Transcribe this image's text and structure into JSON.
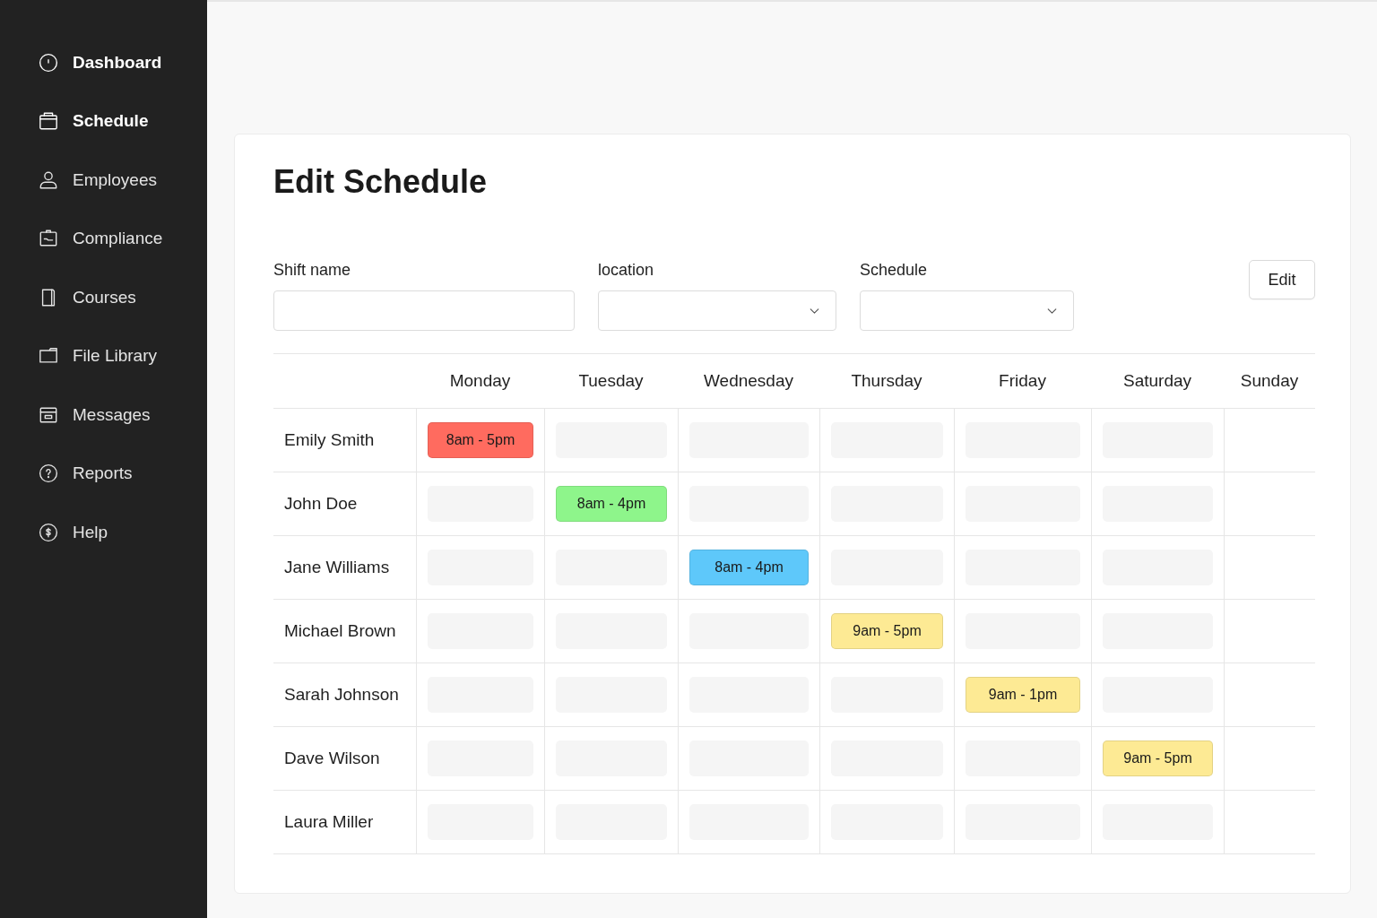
{
  "sidebar": {
    "items": [
      {
        "label": "Dashboard",
        "active": true
      },
      {
        "label": "Schedule",
        "active": true
      },
      {
        "label": "Employees",
        "active": false
      },
      {
        "label": "Compliance",
        "active": false
      },
      {
        "label": "Courses",
        "active": false
      },
      {
        "label": "File Library",
        "active": false
      },
      {
        "label": "Messages",
        "active": false
      },
      {
        "label": "Reports",
        "active": false
      },
      {
        "label": "Help",
        "active": false
      }
    ]
  },
  "card": {
    "title": "Edit Schedule",
    "form": {
      "fields": [
        {
          "label": "Shift name",
          "kind": "text"
        },
        {
          "label": "location",
          "kind": "select"
        },
        {
          "label": "Schedule",
          "kind": "select"
        }
      ],
      "button": "Edit"
    },
    "table": {
      "columns": [
        "Monday",
        "Tuesday",
        "Wednesday",
        "Thursday",
        "Friday",
        "Saturday",
        "Sunday"
      ],
      "rows": [
        {
          "name": "Emily Smith",
          "cells": [
            {
              "kind": "shift",
              "label": "8am - 5pm",
              "color": "#ff6b5f"
            },
            {
              "kind": "slot"
            },
            {
              "kind": "slot"
            },
            {
              "kind": "slot"
            },
            {
              "kind": "slot"
            },
            {
              "kind": "slot"
            }
          ]
        },
        {
          "name": "John Doe",
          "cells": [
            {
              "kind": "slot"
            },
            {
              "kind": "shift",
              "label": "8am - 4pm",
              "color": "#8ef58b"
            },
            {
              "kind": "slot"
            },
            {
              "kind": "slot"
            },
            {
              "kind": "slot"
            },
            {
              "kind": "slot"
            }
          ]
        },
        {
          "name": "Jane Williams",
          "cells": [
            {
              "kind": "slot"
            },
            {
              "kind": "slot"
            },
            {
              "kind": "shift",
              "label": "8am - 4pm",
              "color": "#5ec8fa"
            },
            {
              "kind": "slot"
            },
            {
              "kind": "slot"
            },
            {
              "kind": "slot"
            }
          ]
        },
        {
          "name": "Michael Brown",
          "cells": [
            {
              "kind": "slot"
            },
            {
              "kind": "slot"
            },
            {
              "kind": "slot"
            },
            {
              "kind": "shift",
              "label": "9am - 5pm",
              "color": "#fdea94"
            },
            {
              "kind": "slot"
            },
            {
              "kind": "slot"
            }
          ]
        },
        {
          "name": "Sarah Johnson",
          "cells": [
            {
              "kind": "slot"
            },
            {
              "kind": "slot"
            },
            {
              "kind": "slot"
            },
            {
              "kind": "slot"
            },
            {
              "kind": "shift",
              "label": "9am - 1pm",
              "color": "#fdea94"
            },
            {
              "kind": "slot"
            }
          ]
        },
        {
          "name": "Dave Wilson",
          "cells": [
            {
              "kind": "slot"
            },
            {
              "kind": "slot"
            },
            {
              "kind": "slot"
            },
            {
              "kind": "slot"
            },
            {
              "kind": "slot"
            },
            {
              "kind": "shift",
              "label": "9am - 5pm",
              "color": "#fdea94"
            }
          ]
        },
        {
          "name": "Laura Miller",
          "cells": [
            {
              "kind": "slot"
            },
            {
              "kind": "slot"
            },
            {
              "kind": "slot"
            },
            {
              "kind": "slot"
            },
            {
              "kind": "slot"
            },
            {
              "kind": "slot"
            }
          ]
        }
      ]
    }
  }
}
